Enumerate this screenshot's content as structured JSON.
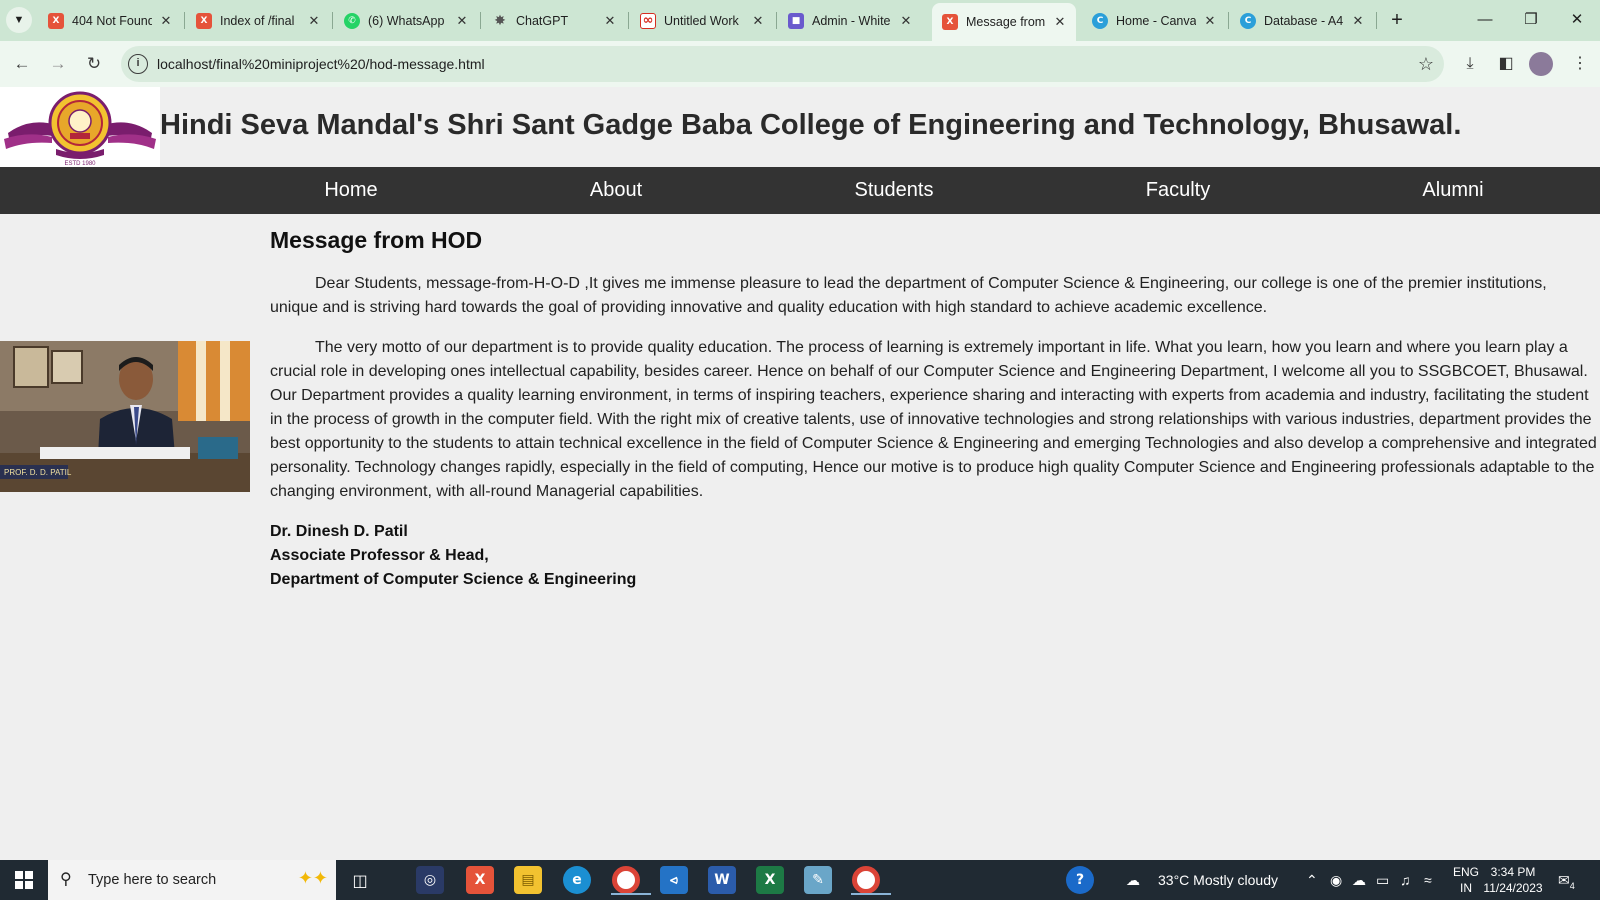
{
  "browser": {
    "tabs": [
      {
        "title": "404 Not Found",
        "favicon": "xampp-icon",
        "color": "#e5533a",
        "glyph": "X"
      },
      {
        "title": "Index of /final",
        "favicon": "xampp-icon",
        "color": "#e5533a",
        "glyph": "X"
      },
      {
        "title": "(6) WhatsApp",
        "favicon": "whatsapp-icon",
        "color": "#25d366",
        "glyph": "✆"
      },
      {
        "title": "ChatGPT",
        "favicon": "chatgpt-icon",
        "color": "#9aa3a0",
        "glyph": "✸"
      },
      {
        "title": "Untitled Work",
        "favicon": "glitch-icon",
        "color": "#d62d20",
        "glyph": "∞"
      },
      {
        "title": "Admin - White",
        "favicon": "admin-icon",
        "color": "#6a5acd",
        "glyph": "■"
      },
      {
        "title": "Message from",
        "favicon": "xampp-icon",
        "color": "#e5533a",
        "glyph": "X",
        "active": true
      },
      {
        "title": "Home - Canva",
        "favicon": "canva-icon",
        "color": "#2b9fd9",
        "glyph": "C"
      },
      {
        "title": "Database - A4",
        "favicon": "canva-icon",
        "color": "#2b9fd9",
        "glyph": "C"
      }
    ],
    "url": "localhost/final%20miniproject%20/hod-message.html"
  },
  "site": {
    "title": "Hindi Seva Mandal's Shri Sant Gadge Baba College of Engineering and Technology, Bhusawal.",
    "logo_text": "ESTD 1980",
    "nav": [
      "Home",
      "About",
      "Students",
      "Faculty",
      "Alumni"
    ]
  },
  "message": {
    "heading": "Message from HOD",
    "paragraphs": [
      "Dear Students, message-from-H-O-D ,It gives me immense pleasure to lead the department of Computer Science & Engineering, our college is one of the premier institutions, unique and is striving hard towards the goal of providing innovative and quality education with high standard to achieve academic excellence.",
      "The very motto of our department is to provide quality education. The process of learning is extremely important in life. What you learn, how you learn and where you learn play a crucial role in developing ones intellectual capability, besides career. Hence on behalf of our Computer Science and Engineering Department, I welcome all you to SSGBCOET, Bhusawal. Our Department provides a quality learning environment, in terms of inspiring teachers, experience sharing and interacting with experts from academia and industry, facilitating the student in the process of growth in the computer field. With the right mix of creative talents, use of innovative technologies and strong relationships with various industries, department provides the best opportunity to the students to attain technical excellence in the field of Computer Science & Engineering and emerging Technologies and also develop a comprehensive and integrated personality. Technology changes rapidly, especially in the field of computing, Hence our motive is to produce high quality Computer Science and Engineering professionals adaptable to the changing environment, with all-round Managerial capabilities."
    ],
    "signature": {
      "name": "Dr. Dinesh D. Patil",
      "designation": "Associate Professor & Head,",
      "department": "Department of Computer Science & Engineering"
    },
    "photo_caption": "PROF. D. D. PATIL"
  },
  "taskbar": {
    "search_placeholder": "Type here to search",
    "weather": "33°C  Mostly cloudy",
    "lang_line1": "ENG",
    "lang_line2": "IN",
    "time": "3:34 PM",
    "date": "11/24/2023",
    "notifications": "4"
  }
}
